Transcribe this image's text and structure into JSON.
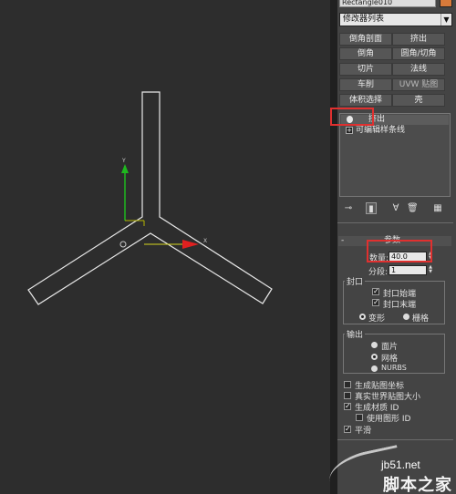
{
  "object_name": "Rectangle010",
  "modifier_list": "修改器列表",
  "modifier_buttons": [
    {
      "label": "倒角剖面"
    },
    {
      "label": "挤出"
    },
    {
      "label": "倒角"
    },
    {
      "label": "圆角/切角"
    },
    {
      "label": "切片"
    },
    {
      "label": "法线"
    },
    {
      "label": "车削"
    },
    {
      "label": "UVW 贴图"
    },
    {
      "label": "体积选择"
    },
    {
      "label": "壳"
    }
  ],
  "stack": {
    "items": [
      {
        "label": "挤出",
        "selected": true
      },
      {
        "label": "可编辑样条线",
        "selected": false
      }
    ]
  },
  "parameters": {
    "title": "参数",
    "amount_label": "数量:",
    "amount_value": "40.0",
    "segments_label": "分段:",
    "segments_value": "1",
    "capping": {
      "title": "封口",
      "cap_start": "封口始端",
      "cap_end": "封口末端",
      "morph": "变形",
      "grid": "栅格",
      "cap_type": "morph"
    },
    "output": {
      "title": "输出",
      "options": [
        "面片",
        "网格",
        "NURBS"
      ],
      "selected": "网格"
    },
    "gen_mapping": "生成贴图坐标",
    "real_world": "真实世界贴图大小",
    "gen_mat_ids": "生成材质 ID",
    "use_shape_ids": "使用图形 ID",
    "smooth": "平滑",
    "checks": {
      "cap_start": true,
      "cap_end": true,
      "gen_mapping": false,
      "real_world": false,
      "gen_mat_ids": true,
      "use_shape_ids": false,
      "smooth": true
    }
  },
  "gizmo": {
    "y_label": "Y",
    "x_label": "X"
  },
  "watermark": {
    "site": "jb51.net",
    "name": "脚本之家"
  },
  "colors": {
    "highlight": "#e0302f",
    "gizmo_x": "#e02020",
    "gizmo_y": "#20c020",
    "shape": "#e8e8e8"
  }
}
